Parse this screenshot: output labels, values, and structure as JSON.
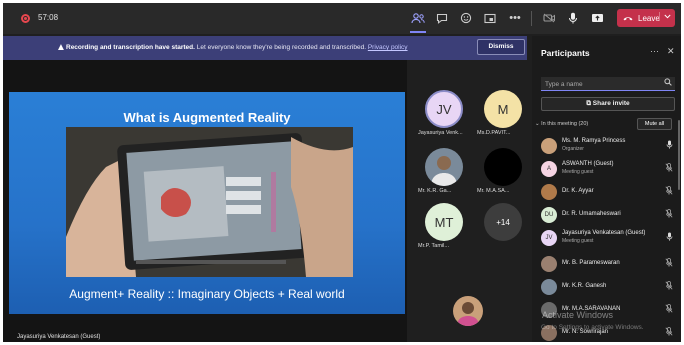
{
  "topbar": {
    "timer": "57:08",
    "leave_label": "Leave"
  },
  "banner": {
    "bold": "Recording and transcription have started.",
    "text": " Let everyone know they're being recorded and transcribed. ",
    "link": "Privacy policy",
    "dismiss_label": "Dismiss"
  },
  "slide": {
    "title": "What is Augmented Reality",
    "caption": "Augment+ Reality :: Imaginary Objects + Real world"
  },
  "stage": {
    "presenter_name": "Jayasuriya Venkatesan (Guest)"
  },
  "gallery": [
    {
      "initials": "JV",
      "name": "Jayasuriya Venk...",
      "color": "#e8d6f5"
    },
    {
      "initials": "M",
      "name": "Ms.D.PAVIT...",
      "color": "#f4e2a6"
    },
    {
      "initials": "",
      "name": "Mr. K.R. Ga...",
      "color": "#7a8a9a"
    },
    {
      "initials": "",
      "name": "Mr. M.A.SA...",
      "color": "#000000"
    },
    {
      "initials": "MT",
      "name": "Mr.P. Tamil...",
      "color": "#dff0d8"
    },
    {
      "initials": "+14",
      "name": "",
      "color": "#3d3d3d"
    }
  ],
  "participants_panel": {
    "title": "Participants",
    "search_placeholder": "Type a name",
    "share_invite_label": "Share invite",
    "in_meeting_label": "In this meeting (20)",
    "mute_all_label": "Mute all",
    "members": [
      {
        "name": "Ms. M. Ramya Princess",
        "sub": "Organizer",
        "initials": "",
        "color": "#c9a07a",
        "mic": "on"
      },
      {
        "name": "ASWANTH (Guest)",
        "sub": "Meeting guest",
        "initials": "A",
        "color": "#f5d4e3",
        "mic": "muted"
      },
      {
        "name": "Dr. K. Ayyar",
        "sub": "",
        "initials": "",
        "color": "#b07a4a",
        "mic": "muted"
      },
      {
        "name": "Dr. R. Umamaheswari",
        "sub": "",
        "initials": "DU",
        "color": "#d8ecd4",
        "mic": "muted"
      },
      {
        "name": "Jayasuriya Venkatesan (Guest)",
        "sub": "Meeting guest",
        "initials": "JV",
        "color": "#e8d6f5",
        "mic": "on"
      },
      {
        "name": "Mr. B. Parameswaran",
        "sub": "",
        "initials": "",
        "color": "#9a8070",
        "mic": "muted"
      },
      {
        "name": "Mr. K.R. Ganesh",
        "sub": "",
        "initials": "",
        "color": "#7a8a9a",
        "mic": "muted"
      },
      {
        "name": "Mr. M.A.SARAVANAN",
        "sub": "",
        "initials": "",
        "color": "#6a6a6a",
        "mic": "muted"
      },
      {
        "name": "Mr. N. Sowrirajan",
        "sub": "",
        "initials": "",
        "color": "#8a7060",
        "mic": "muted"
      }
    ],
    "watermark_title": "Activate Windows",
    "watermark_sub": "Go to Settings to activate Windows."
  }
}
